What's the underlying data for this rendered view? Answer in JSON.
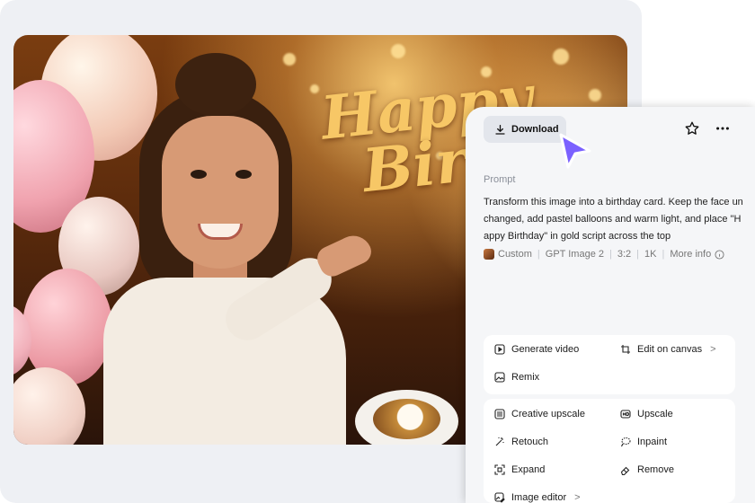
{
  "photo": {
    "headline_line1": "Happy",
    "headline_line2": "Birth"
  },
  "panel": {
    "download_label": "Download",
    "favorite_icon": "star-icon",
    "more_icon": "more-horizontal-icon",
    "prompt_label": "Prompt",
    "prompt_text": "Transform this image into a birthday card. Keep the face unchanged, add pastel balloons and warm light, and place \"Happy Birthday\" in gold script across the top",
    "meta": {
      "style": "Custom",
      "model": "GPT Image 2",
      "ratio": "3:2",
      "resolution": "1K",
      "more_info": "More info"
    },
    "actions_primary": [
      {
        "label": "Generate video",
        "icon": "play-icon"
      },
      {
        "label": "Edit on canvas",
        "icon": "crop-icon",
        "chevron": ">"
      },
      {
        "label": "Remix",
        "icon": "image-icon"
      }
    ],
    "actions_secondary": [
      {
        "label": "Creative upscale",
        "icon": "sliders-icon"
      },
      {
        "label": "Upscale",
        "icon": "hd-icon"
      },
      {
        "label": "Retouch",
        "icon": "magic-wand-icon"
      },
      {
        "label": "Inpaint",
        "icon": "lasso-icon"
      },
      {
        "label": "Expand",
        "icon": "expand-icon"
      },
      {
        "label": "Remove",
        "icon": "eraser-icon"
      },
      {
        "label": "Image editor",
        "icon": "image-edit-icon",
        "chevron": ">"
      }
    ]
  },
  "colors": {
    "accent_cursor": "#7b61ff",
    "headline_gold": "#f7c766",
    "panel_bg": "#f5f6f8"
  }
}
